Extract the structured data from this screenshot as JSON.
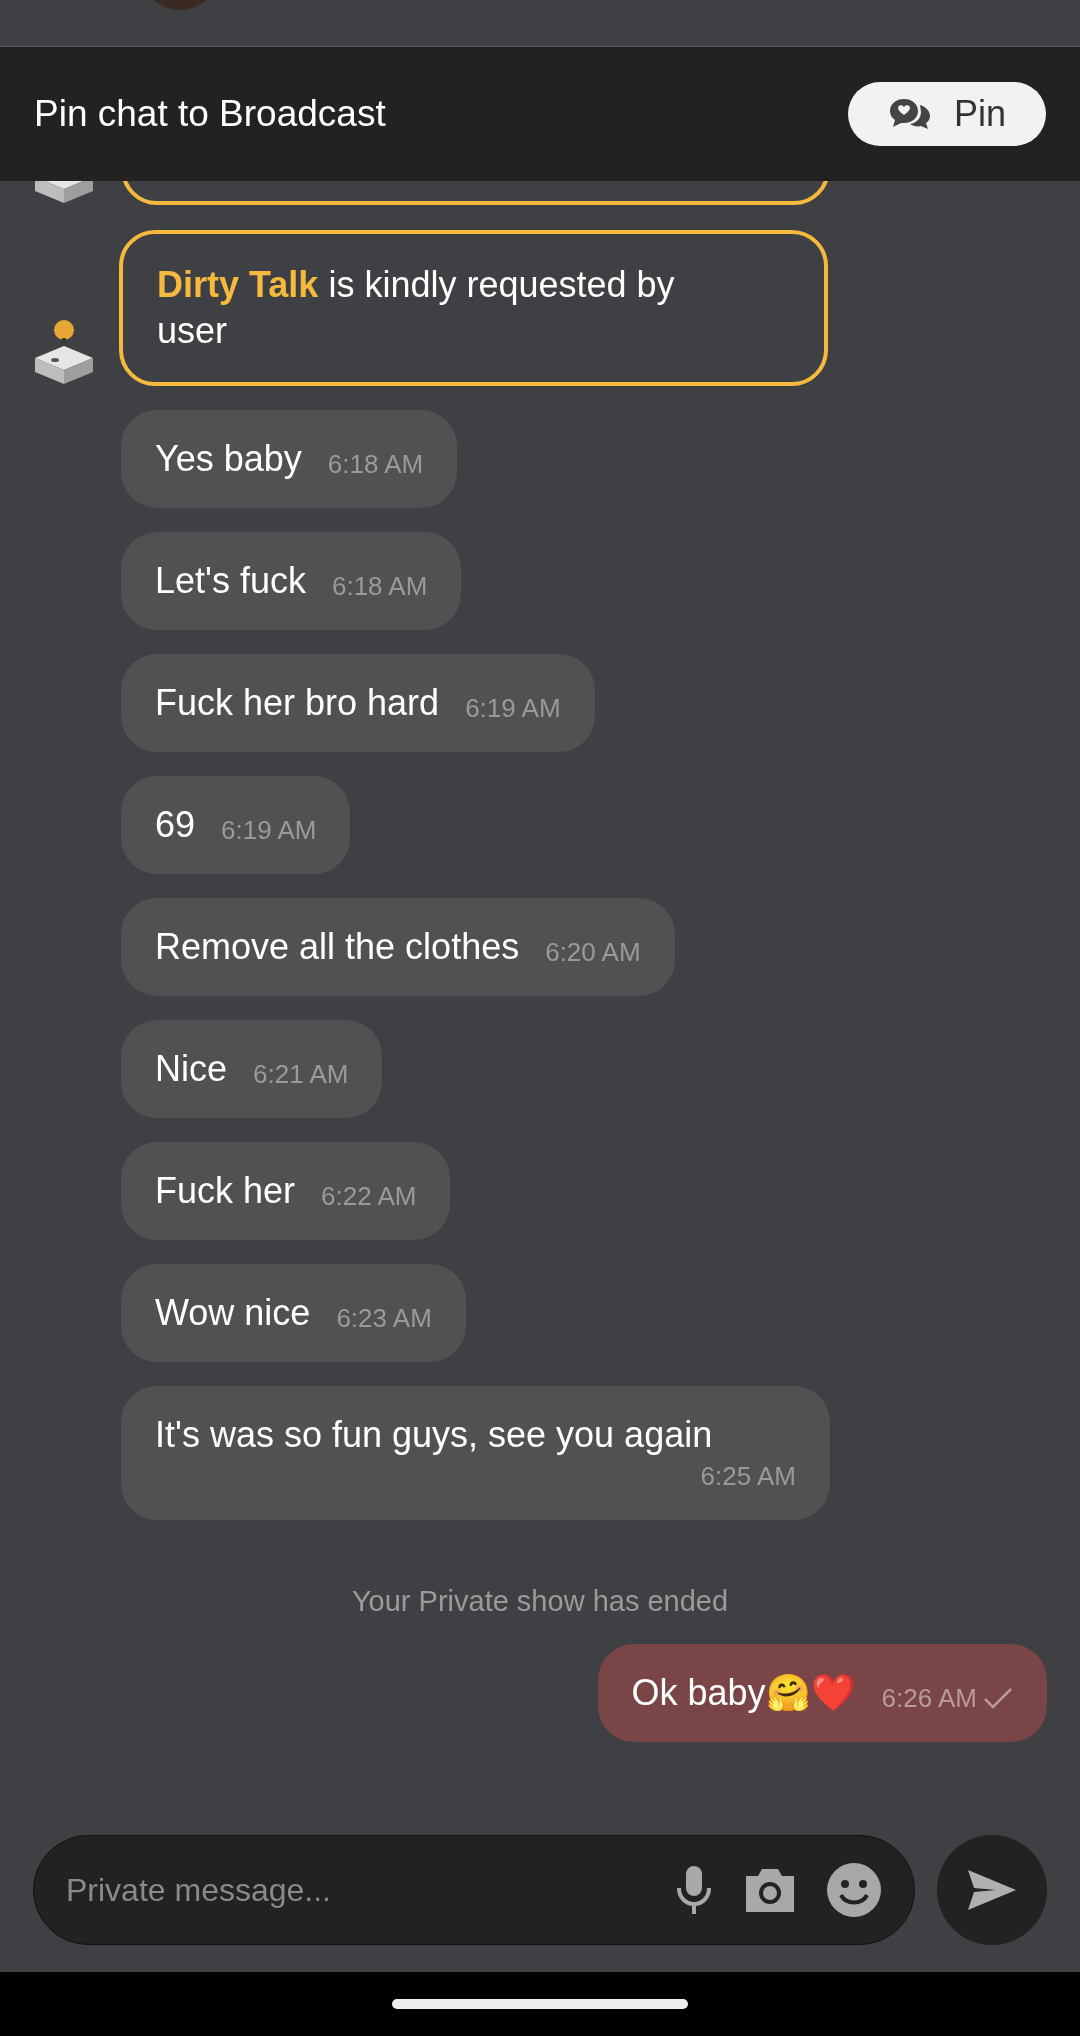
{
  "pin_bar": {
    "label": "Pin chat to Broadcast",
    "button": "Pin"
  },
  "request": {
    "text": "**Dirty Talk** is kindly requested by user"
  },
  "messages": [
    {
      "text": "Yes baby",
      "time": "6:18 AM"
    },
    {
      "text": "Let's fuck",
      "time": "6:18 AM"
    },
    {
      "text": "Fuck her bro hard",
      "time": "6:19 AM"
    },
    {
      "text": "69",
      "time": "6:19 AM"
    },
    {
      "text": "Remove all the clothes",
      "time": "6:20 AM"
    },
    {
      "text": "Nice",
      "time": "6:21 AM"
    },
    {
      "text": "Fuck her",
      "time": "6:22 AM"
    },
    {
      "text": "Wow nice",
      "time": "6:23 AM"
    },
    {
      "text": "It's was so fun guys, see you again",
      "time": "6:25 AM"
    }
  ],
  "system_notice": "Your Private show has ended",
  "own_message": {
    "text": "Ok baby🤗❤️",
    "time": "6:26 AM",
    "delivered": true
  },
  "composer": {
    "placeholder": "Private message..."
  }
}
